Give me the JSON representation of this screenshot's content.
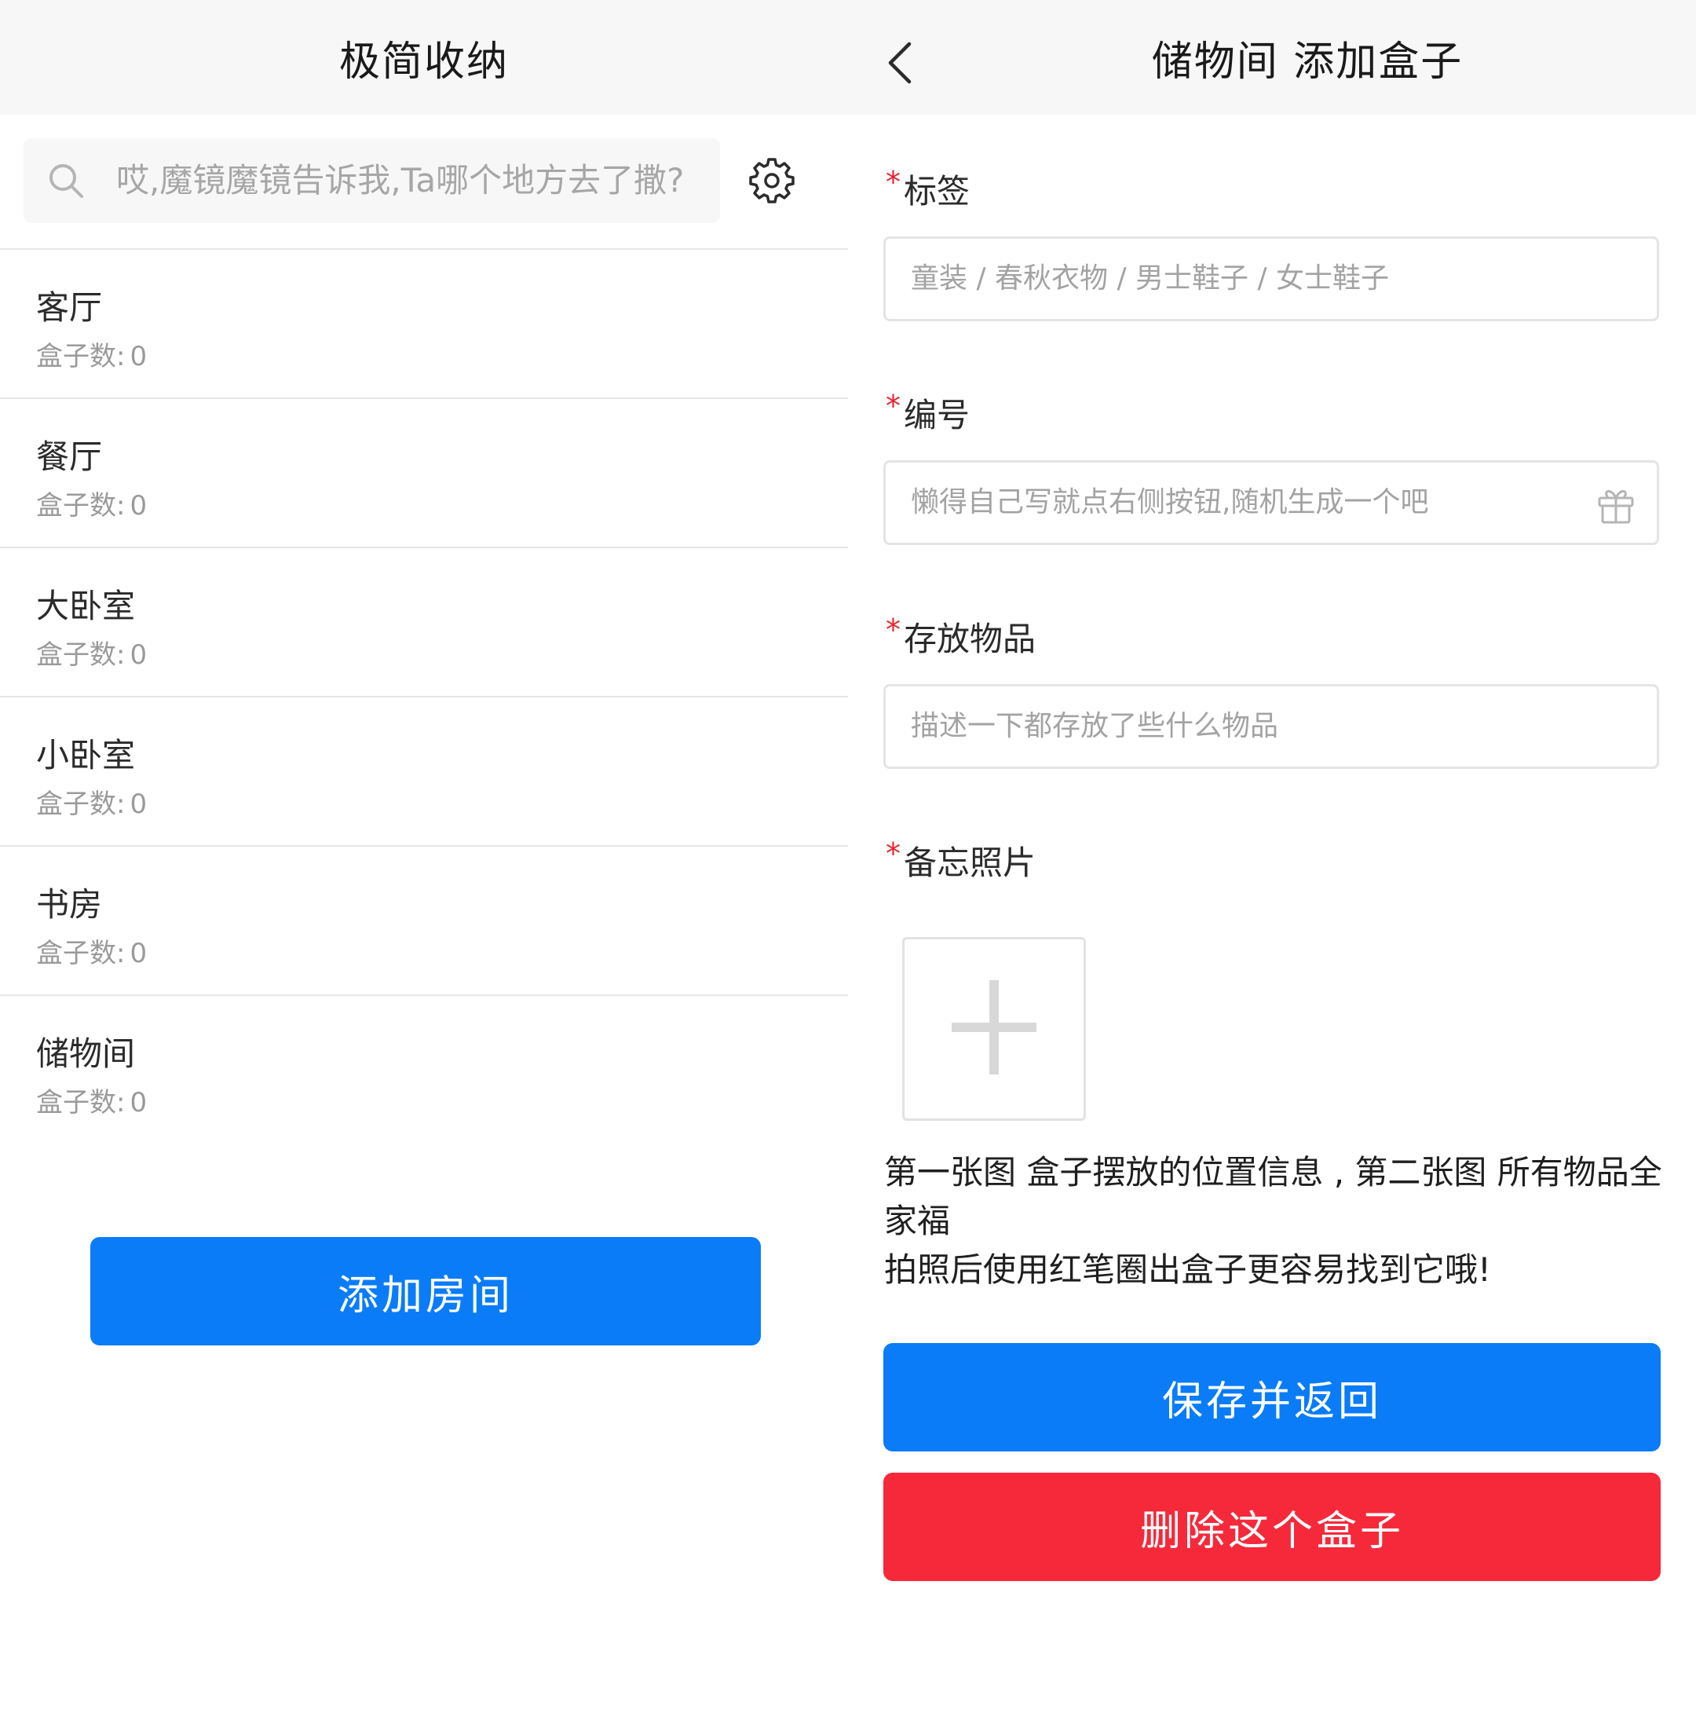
{
  "left": {
    "header": {
      "title": "极简收纳"
    },
    "search": {
      "placeholder": "哎,魔镜魔镜告诉我,Ta哪个地方去了撒?"
    },
    "rooms": [
      {
        "name": "客厅",
        "count_label": "盒子数:",
        "count": "0"
      },
      {
        "name": "餐厅",
        "count_label": "盒子数:",
        "count": "0"
      },
      {
        "name": "大卧室",
        "count_label": "盒子数:",
        "count": "0"
      },
      {
        "name": "小卧室",
        "count_label": "盒子数:",
        "count": "0"
      },
      {
        "name": "书房",
        "count_label": "盒子数:",
        "count": "0"
      },
      {
        "name": "储物间",
        "count_label": "盒子数:",
        "count": "0"
      }
    ],
    "add_room_label": "添加房间"
  },
  "right": {
    "header": {
      "title": "储物间 添加盒子"
    },
    "required_mark": "*",
    "fields": {
      "tag": {
        "label": "标签",
        "placeholder": "童装 / 春秋衣物 / 男士鞋子 / 女士鞋子"
      },
      "number": {
        "label": "编号",
        "placeholder": "懒得自己写就点右侧按钮,随机生成一个吧"
      },
      "items": {
        "label": "存放物品",
        "placeholder": "描述一下都存放了些什么物品"
      },
      "photos": {
        "label": "备忘照片"
      }
    },
    "hint_line1": "第一张图 盒子摆放的位置信息 , 第二张图 所有物品全家福",
    "hint_line2": "拍照后使用红笔圈出盒子更容易找到它哦!",
    "save_label": "保存并返回",
    "delete_label": "删除这个盒子"
  },
  "colors": {
    "primary": "#0a7cf8",
    "danger": "#f6293a",
    "required": "#e8232c",
    "header_bg": "#f7f7f7"
  },
  "icons": [
    "search-icon",
    "gear-icon",
    "back-icon",
    "gift-icon",
    "plus-icon"
  ]
}
